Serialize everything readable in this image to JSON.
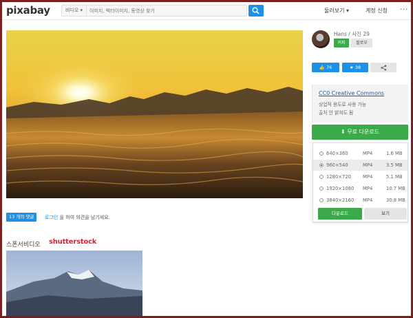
{
  "header": {
    "logo": "pixabay",
    "search_category": "비디오 ▾",
    "search_placeholder": "이미지, 벡터이미지, 동영상 찾기",
    "explore": "둘러보기 ▾",
    "signup": "계정 신청",
    "more": "···"
  },
  "user": {
    "name_line": "Hans / 사진 29",
    "sponsor_button": "커피",
    "follow_button": "팔로우"
  },
  "actions": {
    "likes": "76",
    "favorites": "38"
  },
  "license": {
    "title": "CC0 Creative Commons",
    "line1": "상업적 용도로 사용 가능",
    "line2": "출처 안 밝혀도 됨"
  },
  "download": {
    "main_button": "무료 다운로드",
    "options": [
      {
        "res": "640×360",
        "fmt": "MP4",
        "size": "1.6 MB",
        "selected": false
      },
      {
        "res": "960×540",
        "fmt": "MP4",
        "size": "3.5 MB",
        "selected": true
      },
      {
        "res": "1280×720",
        "fmt": "MP4",
        "size": "5.1 MB",
        "selected": false
      },
      {
        "res": "1920×1080",
        "fmt": "MP4",
        "size": "10.7 MB",
        "selected": false
      },
      {
        "res": "3840×2160",
        "fmt": "MP4",
        "size": "30.8 MB",
        "selected": false
      }
    ],
    "panel_download": "다운로드",
    "panel_view": "보기"
  },
  "comments": {
    "badge": "13 개의 댓글",
    "login_link": "로그인",
    "rest": " 을 하여 의견을 남기세요."
  },
  "sponsor": {
    "label": "스폰서비디오",
    "brand": "shutterstock"
  },
  "colors": {
    "accent_blue": "#1e90e6",
    "accent_green": "#3aaa4a",
    "brand_red": "#e21d2e"
  }
}
